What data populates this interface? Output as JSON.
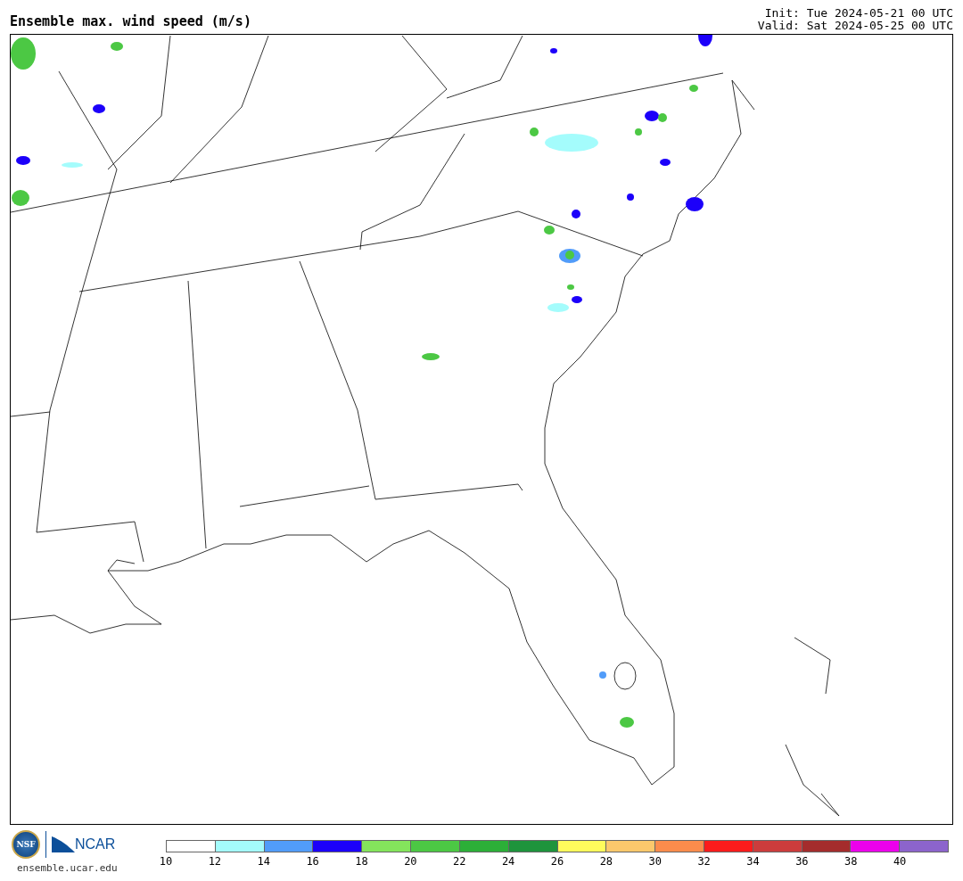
{
  "title": "Ensemble max. wind speed (m/s)",
  "init": "Init: Tue 2024-05-21 00 UTC",
  "valid": "Valid: Sat 2024-05-25 00 UTC",
  "logos": {
    "nsf": "NSF",
    "ncar": "NCAR",
    "url": "ensemble.ucar.edu"
  },
  "colorbar": {
    "segments": [
      {
        "color": "#ffffff"
      },
      {
        "color": "#a4fcfc"
      },
      {
        "color": "#519cf9"
      },
      {
        "color": "#1c00fa"
      },
      {
        "color": "#84e45c"
      },
      {
        "color": "#4cc844"
      },
      {
        "color": "#2caf38"
      },
      {
        "color": "#1e943c"
      },
      {
        "color": "#fffc5c"
      },
      {
        "color": "#fcc86c"
      },
      {
        "color": "#fc8c4c"
      },
      {
        "color": "#fc1c1c"
      },
      {
        "color": "#cc3c3c"
      },
      {
        "color": "#a42c2c"
      },
      {
        "color": "#ec00ec"
      },
      {
        "color": "#8c64cc"
      }
    ],
    "ticks": [
      "10",
      "12",
      "14",
      "16",
      "18",
      "20",
      "22",
      "24",
      "26",
      "28",
      "30",
      "32",
      "34",
      "36",
      "38",
      "40"
    ]
  }
}
